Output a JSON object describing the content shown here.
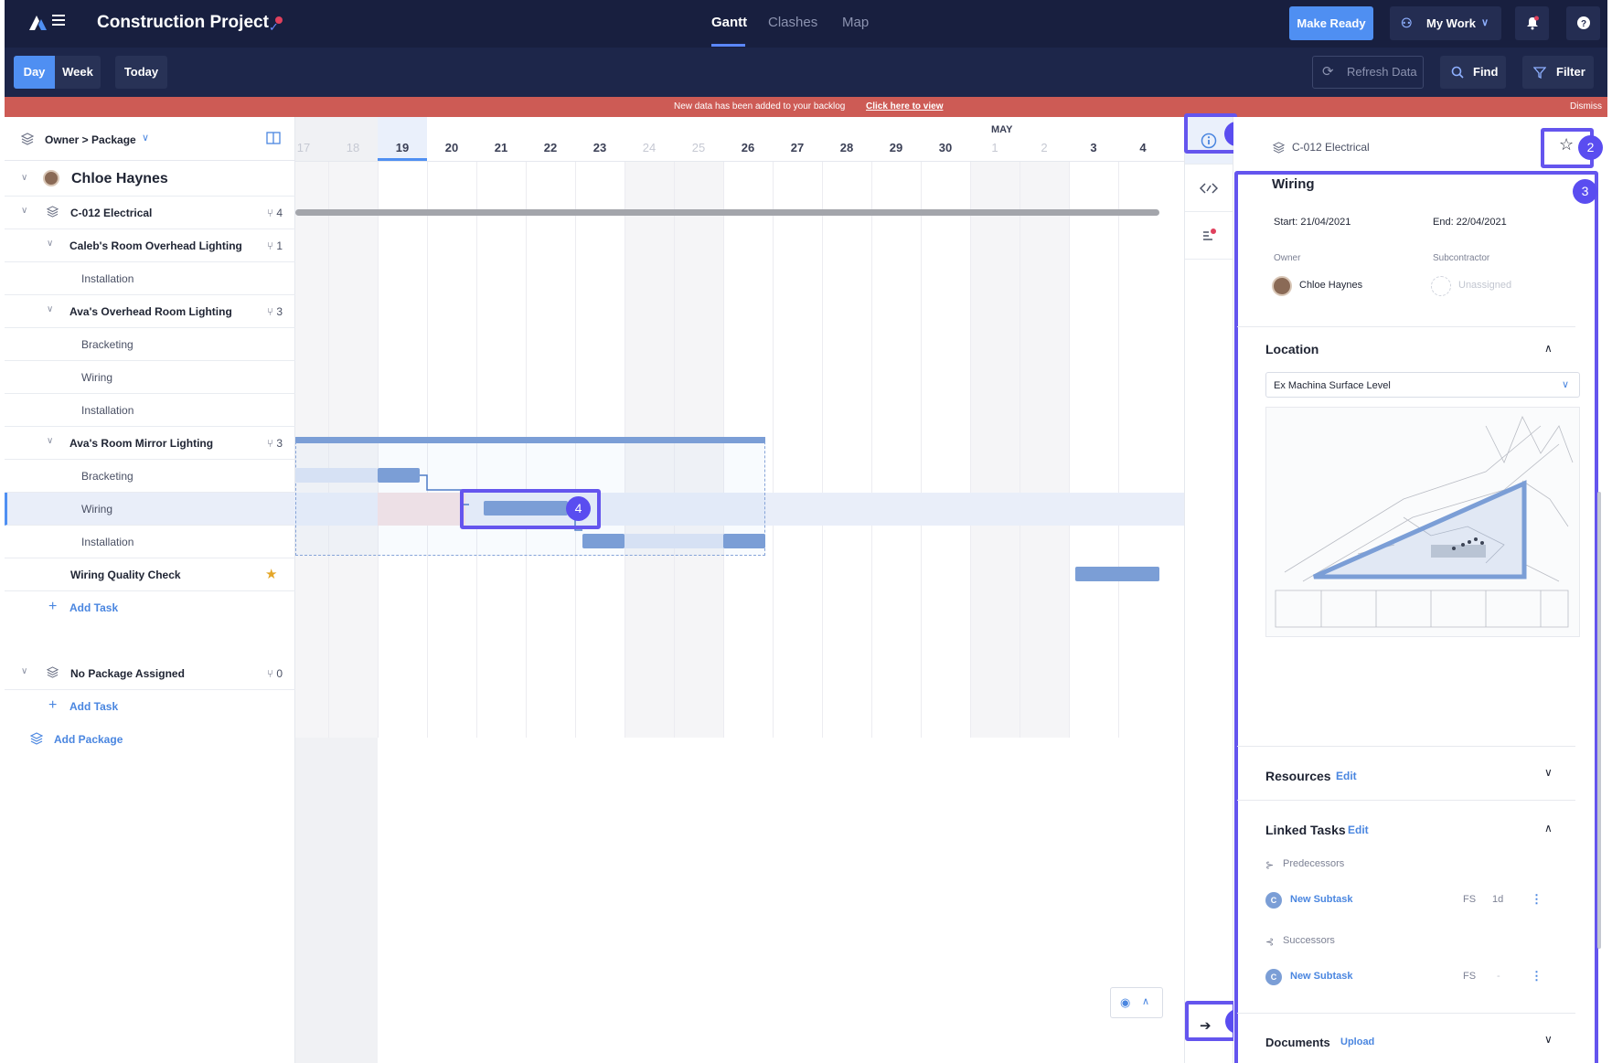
{
  "app": {
    "title": "Construction Project"
  },
  "nav": {
    "tabs": [
      "Gantt",
      "Clashes",
      "Map"
    ],
    "make_ready": "Make Ready",
    "my_work": "My Work"
  },
  "toolbar": {
    "day": "Day",
    "week": "Week",
    "today": "Today",
    "refresh": "Refresh Data",
    "find": "Find",
    "filter": "Filter"
  },
  "banner": {
    "message": "New data has been added to your backlog",
    "link": "Click here to view",
    "dismiss": "Dismiss"
  },
  "left": {
    "grouping": "Owner > Package",
    "owner": "Chloe Haynes",
    "package": {
      "name": "C-012 Electrical",
      "count": "4"
    },
    "groups": [
      {
        "name": "Caleb's Room Overhead Lighting",
        "count": "1",
        "tasks": [
          "Installation"
        ]
      },
      {
        "name": "Ava's Overhead Room Lighting",
        "count": "3",
        "tasks": [
          "Bracketing",
          "Wiring",
          "Installation"
        ]
      },
      {
        "name": "Ava's Room Mirror Lighting",
        "count": "3",
        "tasks": [
          "Bracketing",
          "Wiring",
          "Installation"
        ]
      }
    ],
    "quality_check": "Wiring Quality Check",
    "add_task": "Add Task",
    "no_package": {
      "name": "No Package Assigned",
      "count": "0"
    },
    "add_package": "Add Package"
  },
  "gantt": {
    "month": "MAY",
    "days": [
      {
        "d": "17",
        "dim": true
      },
      {
        "d": "18",
        "dim": true
      },
      {
        "d": "19",
        "dim": false
      },
      {
        "d": "20",
        "dim": false
      },
      {
        "d": "21",
        "dim": false
      },
      {
        "d": "22",
        "dim": false
      },
      {
        "d": "23",
        "dim": false
      },
      {
        "d": "24",
        "dim": true
      },
      {
        "d": "25",
        "dim": true
      },
      {
        "d": "26",
        "dim": false
      },
      {
        "d": "27",
        "dim": false
      },
      {
        "d": "28",
        "dim": false
      },
      {
        "d": "29",
        "dim": false
      },
      {
        "d": "30",
        "dim": false
      },
      {
        "d": "1",
        "dim": true
      },
      {
        "d": "2",
        "dim": true
      },
      {
        "d": "3",
        "dim": false
      },
      {
        "d": "4",
        "dim": false
      }
    ]
  },
  "callouts": [
    "1",
    "2",
    "3",
    "4",
    "5"
  ],
  "detail": {
    "package": "C-012 Electrical",
    "task": "Wiring",
    "start": "Start: 21/04/2021",
    "end": "End: 22/04/2021",
    "owner_label": "Owner",
    "owner": "Chloe Haynes",
    "sub_label": "Subcontractor",
    "sub": "Unassigned",
    "location": "Location",
    "location_value": "Ex Machina Surface Level",
    "resources": "Resources",
    "edit": "Edit",
    "linked": "Linked Tasks",
    "predecessors": "Predecessors",
    "successors": "Successors",
    "pred": {
      "badge": "C",
      "name": "New Subtask",
      "type": "FS",
      "lag": "1d"
    },
    "succ": {
      "badge": "C",
      "name": "New Subtask",
      "type": "FS",
      "lag": "-"
    },
    "documents": "Documents",
    "upload": "Upload"
  }
}
